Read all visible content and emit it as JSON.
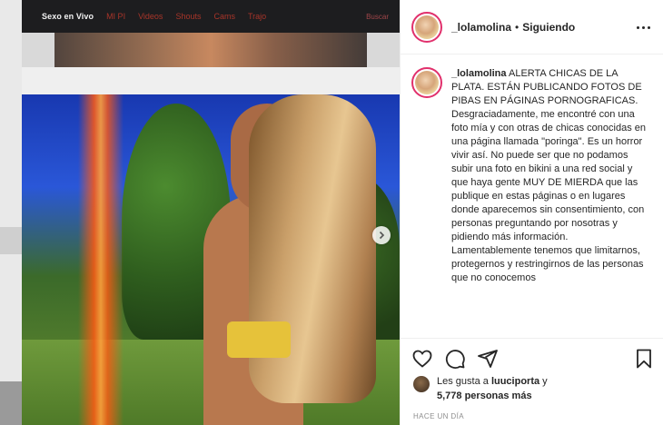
{
  "site_screenshot": {
    "brand": "Sexo en Vivo",
    "nav_links": [
      "MI PI",
      "Videos",
      "Shouts",
      "Cams",
      "Trajo"
    ],
    "search": "Buscar"
  },
  "post": {
    "username": "_lolamolina",
    "separator": "•",
    "follow_status": "Siguiendo",
    "caption_username": "_lolamolina",
    "caption_lines": [
      "ALERTA CHICAS DE LA PLATA. ESTÁN PUBLICANDO FOTOS DE PIBAS EN PÁGINAS PORNOGRAFICAS.",
      "Desgraciadamente, me encontré con una foto mía y con otras de chicas conocidas en una página llamada \"poringa\". Es un horror vivir así. No puede ser que no podamos subir una foto en bikini a una red social y que haya gente MUY DE MIERDA que las publique en estas páginas o en lugares donde aparecemos sin consentimiento, con personas preguntando por nosotras y pidiendo más información.",
      "Lamentablemente tenemos que limitarnos, protegernos y restringirnos de las personas que no conocemos"
    ],
    "likes_prefix": "Les gusta a",
    "likes_user": "luuciporta",
    "likes_and": "y",
    "likes_count": "5,778 personas más",
    "timestamp": "HACE UN DÍA"
  },
  "icons": {
    "more": "more-options-icon",
    "like": "heart-icon",
    "comment": "comment-icon",
    "share": "share-icon",
    "save": "bookmark-icon",
    "next": "chevron-right-icon"
  },
  "colors": {
    "story_ring": "#e1306c",
    "text": "#262626",
    "muted": "#8e8e8e"
  }
}
